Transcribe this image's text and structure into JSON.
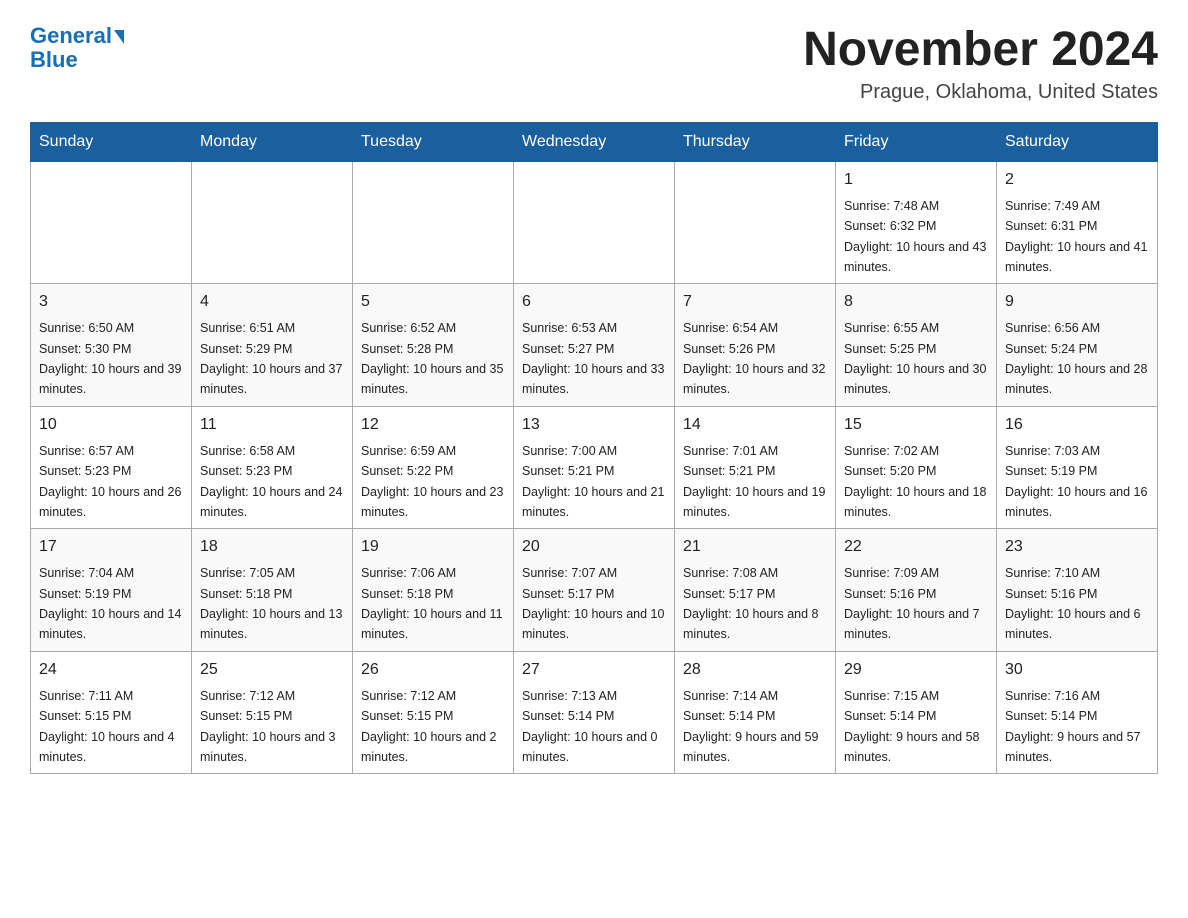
{
  "logo": {
    "text_general": "General",
    "text_blue": "Blue"
  },
  "header": {
    "month": "November 2024",
    "location": "Prague, Oklahoma, United States"
  },
  "weekdays": [
    "Sunday",
    "Monday",
    "Tuesday",
    "Wednesday",
    "Thursday",
    "Friday",
    "Saturday"
  ],
  "weeks": [
    [
      {
        "day": "",
        "sunrise": "",
        "sunset": "",
        "daylight": ""
      },
      {
        "day": "",
        "sunrise": "",
        "sunset": "",
        "daylight": ""
      },
      {
        "day": "",
        "sunrise": "",
        "sunset": "",
        "daylight": ""
      },
      {
        "day": "",
        "sunrise": "",
        "sunset": "",
        "daylight": ""
      },
      {
        "day": "",
        "sunrise": "",
        "sunset": "",
        "daylight": ""
      },
      {
        "day": "1",
        "sunrise": "Sunrise: 7:48 AM",
        "sunset": "Sunset: 6:32 PM",
        "daylight": "Daylight: 10 hours and 43 minutes."
      },
      {
        "day": "2",
        "sunrise": "Sunrise: 7:49 AM",
        "sunset": "Sunset: 6:31 PM",
        "daylight": "Daylight: 10 hours and 41 minutes."
      }
    ],
    [
      {
        "day": "3",
        "sunrise": "Sunrise: 6:50 AM",
        "sunset": "Sunset: 5:30 PM",
        "daylight": "Daylight: 10 hours and 39 minutes."
      },
      {
        "day": "4",
        "sunrise": "Sunrise: 6:51 AM",
        "sunset": "Sunset: 5:29 PM",
        "daylight": "Daylight: 10 hours and 37 minutes."
      },
      {
        "day": "5",
        "sunrise": "Sunrise: 6:52 AM",
        "sunset": "Sunset: 5:28 PM",
        "daylight": "Daylight: 10 hours and 35 minutes."
      },
      {
        "day": "6",
        "sunrise": "Sunrise: 6:53 AM",
        "sunset": "Sunset: 5:27 PM",
        "daylight": "Daylight: 10 hours and 33 minutes."
      },
      {
        "day": "7",
        "sunrise": "Sunrise: 6:54 AM",
        "sunset": "Sunset: 5:26 PM",
        "daylight": "Daylight: 10 hours and 32 minutes."
      },
      {
        "day": "8",
        "sunrise": "Sunrise: 6:55 AM",
        "sunset": "Sunset: 5:25 PM",
        "daylight": "Daylight: 10 hours and 30 minutes."
      },
      {
        "day": "9",
        "sunrise": "Sunrise: 6:56 AM",
        "sunset": "Sunset: 5:24 PM",
        "daylight": "Daylight: 10 hours and 28 minutes."
      }
    ],
    [
      {
        "day": "10",
        "sunrise": "Sunrise: 6:57 AM",
        "sunset": "Sunset: 5:23 PM",
        "daylight": "Daylight: 10 hours and 26 minutes."
      },
      {
        "day": "11",
        "sunrise": "Sunrise: 6:58 AM",
        "sunset": "Sunset: 5:23 PM",
        "daylight": "Daylight: 10 hours and 24 minutes."
      },
      {
        "day": "12",
        "sunrise": "Sunrise: 6:59 AM",
        "sunset": "Sunset: 5:22 PM",
        "daylight": "Daylight: 10 hours and 23 minutes."
      },
      {
        "day": "13",
        "sunrise": "Sunrise: 7:00 AM",
        "sunset": "Sunset: 5:21 PM",
        "daylight": "Daylight: 10 hours and 21 minutes."
      },
      {
        "day": "14",
        "sunrise": "Sunrise: 7:01 AM",
        "sunset": "Sunset: 5:21 PM",
        "daylight": "Daylight: 10 hours and 19 minutes."
      },
      {
        "day": "15",
        "sunrise": "Sunrise: 7:02 AM",
        "sunset": "Sunset: 5:20 PM",
        "daylight": "Daylight: 10 hours and 18 minutes."
      },
      {
        "day": "16",
        "sunrise": "Sunrise: 7:03 AM",
        "sunset": "Sunset: 5:19 PM",
        "daylight": "Daylight: 10 hours and 16 minutes."
      }
    ],
    [
      {
        "day": "17",
        "sunrise": "Sunrise: 7:04 AM",
        "sunset": "Sunset: 5:19 PM",
        "daylight": "Daylight: 10 hours and 14 minutes."
      },
      {
        "day": "18",
        "sunrise": "Sunrise: 7:05 AM",
        "sunset": "Sunset: 5:18 PM",
        "daylight": "Daylight: 10 hours and 13 minutes."
      },
      {
        "day": "19",
        "sunrise": "Sunrise: 7:06 AM",
        "sunset": "Sunset: 5:18 PM",
        "daylight": "Daylight: 10 hours and 11 minutes."
      },
      {
        "day": "20",
        "sunrise": "Sunrise: 7:07 AM",
        "sunset": "Sunset: 5:17 PM",
        "daylight": "Daylight: 10 hours and 10 minutes."
      },
      {
        "day": "21",
        "sunrise": "Sunrise: 7:08 AM",
        "sunset": "Sunset: 5:17 PM",
        "daylight": "Daylight: 10 hours and 8 minutes."
      },
      {
        "day": "22",
        "sunrise": "Sunrise: 7:09 AM",
        "sunset": "Sunset: 5:16 PM",
        "daylight": "Daylight: 10 hours and 7 minutes."
      },
      {
        "day": "23",
        "sunrise": "Sunrise: 7:10 AM",
        "sunset": "Sunset: 5:16 PM",
        "daylight": "Daylight: 10 hours and 6 minutes."
      }
    ],
    [
      {
        "day": "24",
        "sunrise": "Sunrise: 7:11 AM",
        "sunset": "Sunset: 5:15 PM",
        "daylight": "Daylight: 10 hours and 4 minutes."
      },
      {
        "day": "25",
        "sunrise": "Sunrise: 7:12 AM",
        "sunset": "Sunset: 5:15 PM",
        "daylight": "Daylight: 10 hours and 3 minutes."
      },
      {
        "day": "26",
        "sunrise": "Sunrise: 7:12 AM",
        "sunset": "Sunset: 5:15 PM",
        "daylight": "Daylight: 10 hours and 2 minutes."
      },
      {
        "day": "27",
        "sunrise": "Sunrise: 7:13 AM",
        "sunset": "Sunset: 5:14 PM",
        "daylight": "Daylight: 10 hours and 0 minutes."
      },
      {
        "day": "28",
        "sunrise": "Sunrise: 7:14 AM",
        "sunset": "Sunset: 5:14 PM",
        "daylight": "Daylight: 9 hours and 59 minutes."
      },
      {
        "day": "29",
        "sunrise": "Sunrise: 7:15 AM",
        "sunset": "Sunset: 5:14 PM",
        "daylight": "Daylight: 9 hours and 58 minutes."
      },
      {
        "day": "30",
        "sunrise": "Sunrise: 7:16 AM",
        "sunset": "Sunset: 5:14 PM",
        "daylight": "Daylight: 9 hours and 57 minutes."
      }
    ]
  ]
}
